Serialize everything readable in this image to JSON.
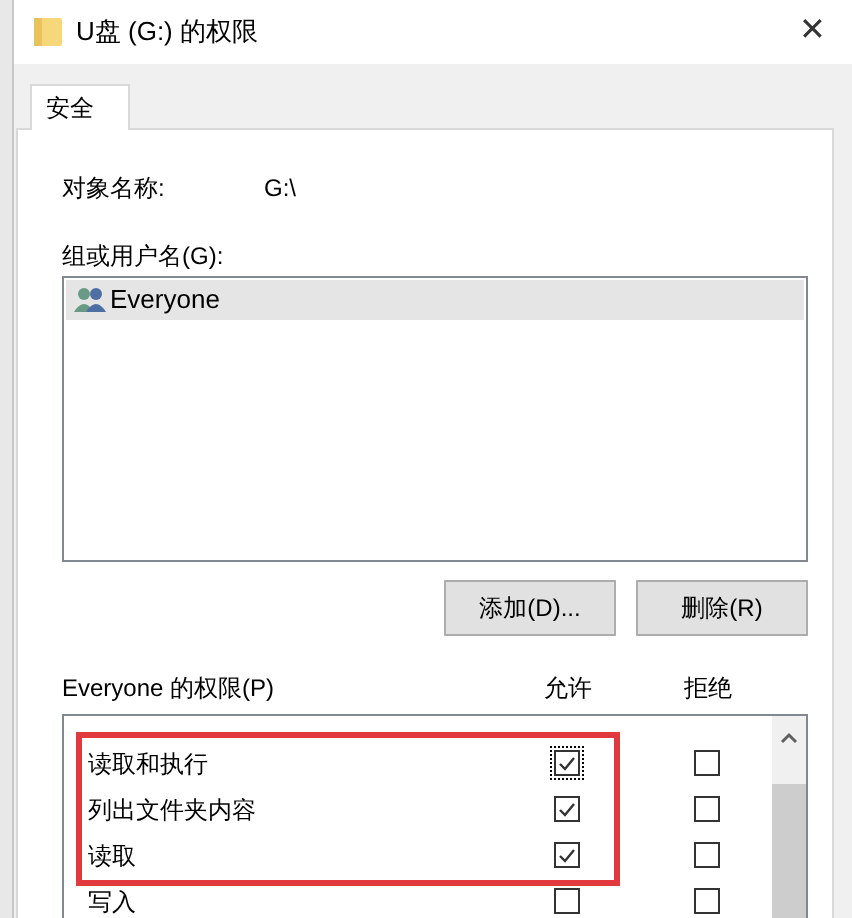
{
  "window": {
    "title": "U盘 (G:) 的权限",
    "close": "✕"
  },
  "tabs": [
    {
      "label": "安全",
      "selected": true
    }
  ],
  "object_name": {
    "label": "对象名称:",
    "value": "G:\\"
  },
  "users": {
    "label": "组或用户名(G):",
    "items": [
      {
        "name": "Everyone",
        "selected": true
      }
    ]
  },
  "buttons": [
    "添加(D)...",
    "删除(R)"
  ],
  "permissions": {
    "label": "Everyone 的权限(P)",
    "allow_header": "允许",
    "deny_header": "拒绝",
    "rows": [
      {
        "name": "读取和执行",
        "allow": true,
        "deny": false,
        "focused": true,
        "highlighted": true
      },
      {
        "name": "列出文件夹内容",
        "allow": true,
        "deny": false,
        "focused": false,
        "highlighted": true
      },
      {
        "name": "读取",
        "allow": true,
        "deny": false,
        "focused": false,
        "highlighted": true
      },
      {
        "name": "写入",
        "allow": false,
        "deny": false,
        "focused": false,
        "highlighted": false
      }
    ]
  }
}
